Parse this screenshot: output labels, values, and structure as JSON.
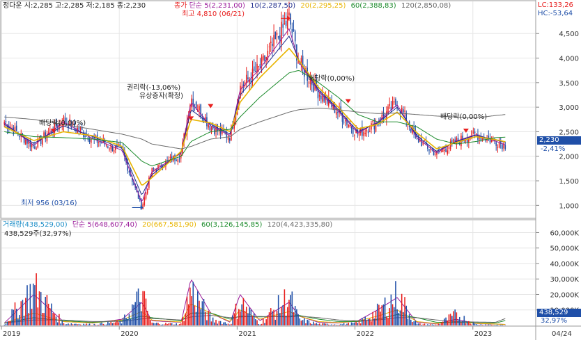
{
  "price_header": {
    "stock": "정다운",
    "ohlc": "시:2,285 고:2,285 저:2,185 종:2,230",
    "close_label": "종가",
    "ma_label": "단순",
    "ma5": "5(2,231,00)",
    "ma10": "10(2,287,50)",
    "ma20": "20(2,295,25)",
    "ma60": "60(2,388,83)",
    "ma120": "120(2,850,08)",
    "lc": "LC:133,26",
    "hc": "HC:-53,64"
  },
  "volume_header": {
    "vol": "거래량(438,529,00)",
    "ma_label": "단순",
    "ma5": "5(648,607,40)",
    "ma20": "20(667,581,90)",
    "ma60": "60(3,126,145,85)",
    "ma120": "120(4,423,335,80)",
    "sub": "438,529주(32,97%)"
  },
  "annotations": {
    "high": "최고 4,810 (06/21)",
    "low": "최저 956 (03/16)",
    "div1": "배당락(0,00%)",
    "div2": "배당락(0,00%)",
    "div3": "배당락(0,00%)",
    "rights": "권리락(-13,06%)",
    "bonus": "유상증자(확정)"
  },
  "current": {
    "price": "2,230",
    "change": "-2,41%",
    "volume": "438,529",
    "volume_pct": "32,97%"
  },
  "colors": {
    "up": "#e8201f",
    "down": "#1f4fa8",
    "ma5": "#9a1a9a",
    "ma10": "#1f2c8c",
    "ma20": "#e8b400",
    "ma60": "#1a8a2a",
    "ma120": "#6a6a6a",
    "grid": "#e6e6e6"
  },
  "chart_data": [
    {
      "type": "line",
      "title": "정다운",
      "y_ticks": [
        "1,000",
        "1,500",
        "2,000",
        "2,500",
        "3,000",
        "3,500",
        "4,000",
        "4,500"
      ],
      "ylim": [
        750,
        4900
      ],
      "x_ticks": [
        "2019",
        "2020",
        "2021",
        "2022",
        "2023",
        "04/24"
      ],
      "x": [
        "2019-01",
        "2019-04",
        "2019-07",
        "2019-10",
        "2020-01",
        "2020-03",
        "2020-04",
        "2020-07",
        "2020-08",
        "2020-10",
        "2020-12",
        "2021-01",
        "2021-03",
        "2021-06",
        "2021-07",
        "2021-09",
        "2021-11",
        "2022-01",
        "2022-03",
        "2022-05",
        "2022-07",
        "2022-09",
        "2022-11",
        "2023-01",
        "2023-03",
        "2023-04"
      ],
      "series": [
        {
          "name": "종가",
          "values": [
            2700,
            2200,
            2750,
            2350,
            2100,
            956,
            1700,
            2050,
            3200,
            2600,
            2400,
            3400,
            3800,
            4810,
            3900,
            3300,
            2900,
            2450,
            2700,
            3100,
            2350,
            2050,
            2300,
            2450,
            2300,
            2230
          ]
        },
        {
          "name": "5",
          "values": [
            2680,
            2220,
            2700,
            2360,
            2120,
            1050,
            1680,
            2060,
            3100,
            2620,
            2420,
            3350,
            3780,
            4600,
            3920,
            3320,
            2920,
            2470,
            2700,
            3050,
            2380,
            2070,
            2310,
            2440,
            2310,
            2231
          ]
        },
        {
          "name": "10",
          "values": [
            2650,
            2260,
            2620,
            2400,
            2160,
            1200,
            1620,
            2080,
            2950,
            2650,
            2450,
            3250,
            3700,
            4450,
            3950,
            3350,
            2950,
            2500,
            2680,
            3000,
            2420,
            2100,
            2300,
            2430,
            2330,
            2287.5
          ]
        },
        {
          "name": "20",
          "values": [
            2600,
            2320,
            2500,
            2420,
            2200,
            1400,
            1560,
            2100,
            2750,
            2680,
            2500,
            3100,
            3600,
            4200,
            3950,
            3400,
            3000,
            2560,
            2650,
            2900,
            2480,
            2150,
            2280,
            2400,
            2340,
            2295.25
          ]
        },
        {
          "name": "60",
          "values": [
            2500,
            2400,
            2380,
            2350,
            2280,
            1900,
            1800,
            2000,
            2300,
            2500,
            2550,
            2800,
            3200,
            3700,
            3750,
            3500,
            3200,
            2850,
            2700,
            2700,
            2600,
            2350,
            2250,
            2300,
            2380,
            2388.83
          ]
        },
        {
          "name": "120",
          "values": [
            2800,
            2750,
            2650,
            2550,
            2450,
            2350,
            2250,
            2150,
            2200,
            2350,
            2400,
            2550,
            2700,
            2900,
            2950,
            2980,
            2950,
            2900,
            2870,
            2880,
            2850,
            2820,
            2800,
            2780,
            2830,
            2850.08
          ]
        }
      ]
    },
    {
      "type": "bar",
      "title": "거래량",
      "y_ticks": [
        "10,000K",
        "20,000K",
        "30,000K",
        "40,000K",
        "50,000K",
        "60,000K"
      ],
      "ylim": [
        0,
        62000
      ],
      "values_unit": "K",
      "x": [
        "2019-01",
        "2019-04",
        "2019-07",
        "2019-10",
        "2020-01",
        "2020-03",
        "2020-04",
        "2020-07",
        "2020-08",
        "2020-10",
        "2020-12",
        "2021-01",
        "2021-03",
        "2021-06",
        "2021-07",
        "2021-09",
        "2021-11",
        "2022-01",
        "2022-03",
        "2022-05",
        "2022-07",
        "2022-09",
        "2022-11",
        "2023-01",
        "2023-03",
        "2023-04"
      ],
      "series": [
        {
          "name": "거래량",
          "values": [
            2000,
            52000,
            3000,
            1500,
            5000,
            42000,
            3000,
            2000,
            50000,
            9000,
            2000,
            34000,
            2500,
            40000,
            8000,
            2000,
            1500,
            3500,
            19000,
            42000,
            2000,
            1000,
            15000,
            1500,
            1000,
            438.5
          ]
        },
        {
          "name": "5",
          "values": [
            1500,
            20000,
            2500,
            1500,
            4000,
            15000,
            3000,
            2000,
            30000,
            8000,
            2000,
            20000,
            3000,
            15000,
            6000,
            2000,
            1500,
            3000,
            10000,
            18000,
            2000,
            1000,
            4000,
            1200,
            900,
            648.6
          ]
        },
        {
          "name": "20",
          "values": [
            1400,
            8000,
            2500,
            1600,
            3500,
            9000,
            3500,
            2200,
            14000,
            8000,
            2500,
            10000,
            4000,
            9000,
            6000,
            2500,
            1800,
            2800,
            6000,
            10000,
            2500,
            1200,
            2500,
            1300,
            900,
            667.6
          ]
        },
        {
          "name": "60",
          "values": [
            1500,
            5000,
            3000,
            2000,
            3000,
            6000,
            5000,
            3000,
            8000,
            8000,
            4000,
            6000,
            5500,
            6000,
            6500,
            4000,
            2500,
            2500,
            4000,
            7000,
            5000,
            2000,
            2000,
            2000,
            1500,
            3126.1
          ]
        },
        {
          "name": "120",
          "values": [
            1500,
            3500,
            3500,
            2500,
            2600,
            4200,
            4500,
            3500,
            5500,
            6500,
            5000,
            5500,
            5800,
            5500,
            6000,
            5000,
            3500,
            3000,
            3500,
            5000,
            5000,
            3500,
            2500,
            2200,
            2000,
            4423.3
          ]
        }
      ]
    }
  ]
}
